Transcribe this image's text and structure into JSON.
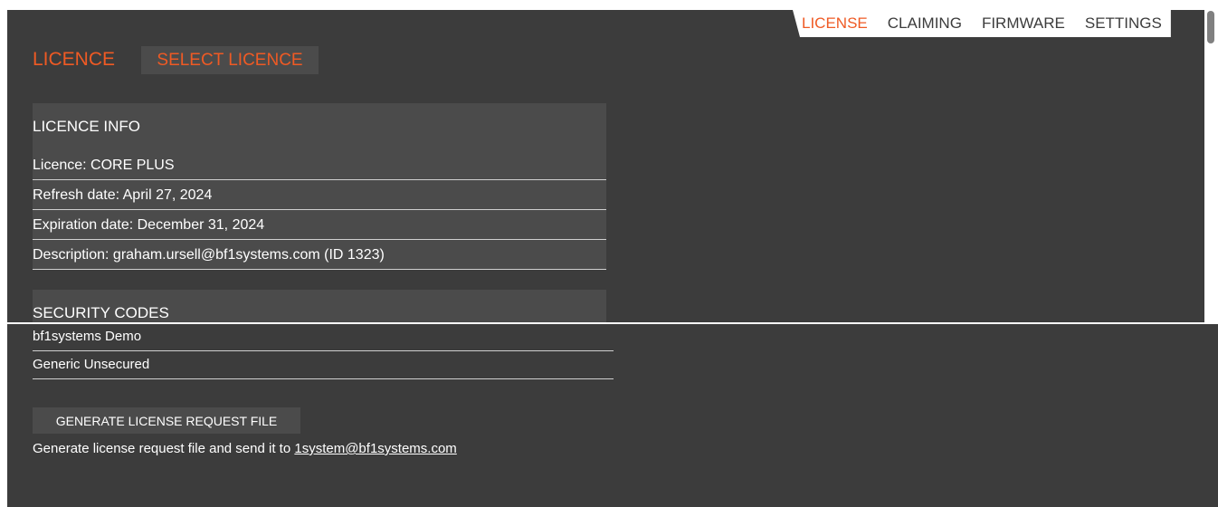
{
  "nav": {
    "tabs": [
      {
        "label": "LICENSE",
        "active": true
      },
      {
        "label": "CLAIMING",
        "active": false
      },
      {
        "label": "FIRMWARE",
        "active": false
      },
      {
        "label": "SETTINGS",
        "active": false
      }
    ]
  },
  "header": {
    "title": "LICENCE",
    "select_button": "SELECT LICENCE"
  },
  "licence_info": {
    "heading": "LICENCE INFO",
    "rows": [
      "Licence: CORE PLUS",
      "Refresh date: April 27, 2024",
      "Expiration date: December 31, 2024",
      "Description: graham.ursell@bf1systems.com (ID 1323)"
    ]
  },
  "security_codes": {
    "heading": "SECURITY CODES",
    "items": [
      "bf1systems Demo",
      "Generic Unsecured"
    ]
  },
  "request": {
    "button": "GENERATE LICENSE REQUEST FILE",
    "note": "Generate license request file and send it to",
    "email": "1system@bf1systems.com"
  },
  "colors": {
    "background": "#3c3c3c",
    "card": "#4b4b4b",
    "accent": "#ef5a24"
  }
}
